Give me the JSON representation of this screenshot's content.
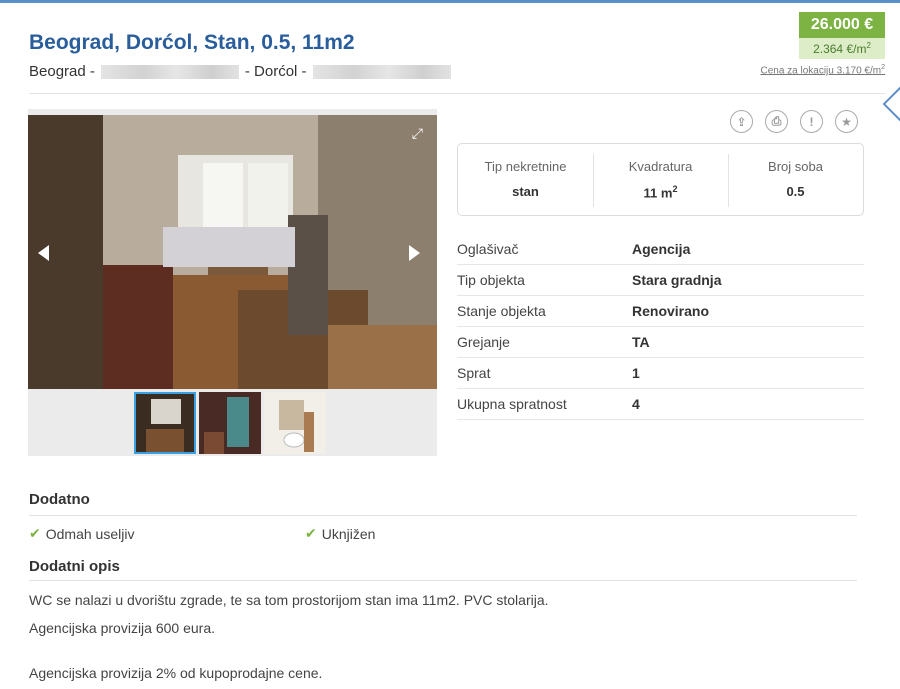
{
  "listing": {
    "title": "Beograd, Dorćol, Stan, 0.5, 11m2",
    "location_city": "Beograd -",
    "location_mid": "- Dorćol -"
  },
  "price": {
    "total": "26.000 €",
    "per_m2": "2.364 €/m",
    "per_m2_sup": "2",
    "location_price": "Cena za lokaciju 3.170 €/m",
    "location_price_sup": "2"
  },
  "summary": {
    "type_label": "Tip nekretnine",
    "type_value": "stan",
    "area_label": "Kvadratura",
    "area_value": "11 m",
    "area_sup": "2",
    "rooms_label": "Broj soba",
    "rooms_value": "0.5"
  },
  "details": [
    {
      "label": "Oglašivač",
      "value": "Agencija"
    },
    {
      "label": "Tip objekta",
      "value": "Stara gradnja"
    },
    {
      "label": "Stanje objekta",
      "value": "Renovirano"
    },
    {
      "label": "Grejanje",
      "value": "TA"
    },
    {
      "label": "Sprat",
      "value": "1"
    },
    {
      "label": "Ukupna spratnost",
      "value": "4"
    }
  ],
  "extras": {
    "heading": "Dodatno",
    "items": [
      "Odmah useljiv",
      "Uknjižen"
    ]
  },
  "description": {
    "heading": "Dodatni opis",
    "lines": [
      "WC se nalazi u dvorištu zgrade, te sa tom prostorijom stan ima 11m2. PVC stolarija.",
      "Agencijska provizija 600 eura.",
      "Agencijska provizija 2% od kupoprodajne cene."
    ]
  },
  "icons": {
    "share": "share-icon",
    "print": "print-icon",
    "report": "report-icon",
    "favorite": "star-icon",
    "expand": "expand-icon",
    "check": "check-icon"
  },
  "colors": {
    "title": "#2a5d9b",
    "price_bg": "#7cb342",
    "price_m2_bg": "#dcedc8",
    "check": "#7cb342",
    "thumb_active": "#3aa0e0"
  }
}
